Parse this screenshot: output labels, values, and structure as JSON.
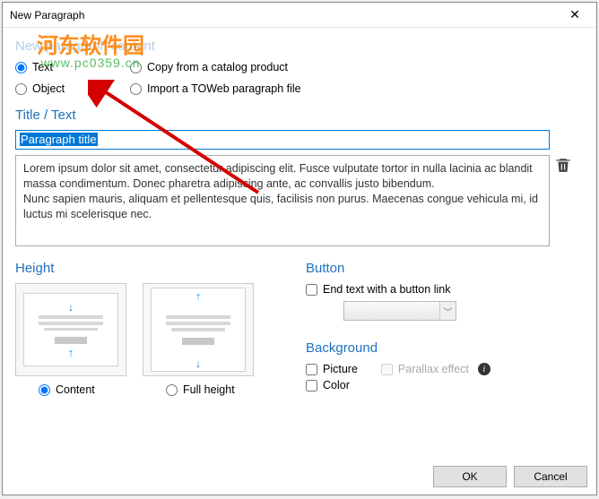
{
  "window": {
    "title": "New Paragraph"
  },
  "section_content_title": "New paragraph content",
  "radios": {
    "text": "Text",
    "object": "Object",
    "copy": "Copy from a catalog product",
    "import": "Import a TOWeb paragraph file"
  },
  "title_section": "Title / Text",
  "title_input_value": "Paragraph title",
  "lorem": "Lorem ipsum dolor sit amet, consectetur adipiscing elit. Fusce vulputate tortor in nulla lacinia ac blandit massa condimentum. Donec pharetra adipiscing ante, ac convallis justo bibendum.\nNunc sapien mauris, aliquam et pellentesque quis, facilisis non purus. Maecenas congue vehicula mi, id luctus mi scelerisque nec.",
  "height": {
    "title": "Height",
    "content": "Content",
    "full": "Full height"
  },
  "button": {
    "title": "Button",
    "endtext": "End text with a button link"
  },
  "background": {
    "title": "Background",
    "picture": "Picture",
    "parallax": "Parallax effect",
    "color": "Color"
  },
  "footer": {
    "ok": "OK",
    "cancel": "Cancel"
  },
  "watermark": {
    "ch": "河东软件园",
    "url": "www.pc0359.cn"
  }
}
